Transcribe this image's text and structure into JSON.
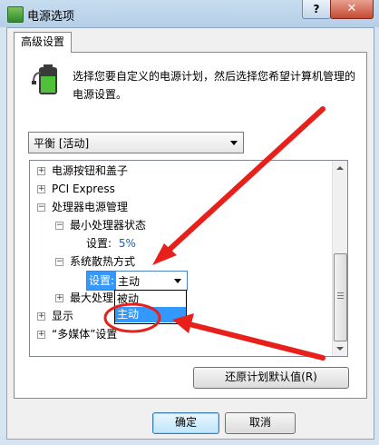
{
  "window": {
    "title": "电源选项",
    "help_label": "?",
    "close_label": "✕"
  },
  "tab": {
    "label": "高级设置"
  },
  "description": "选择您要自定义的电源计划，然后选择您希望计算机管理的电源设置。",
  "plan_select": {
    "value": "平衡 [活动]"
  },
  "tree": {
    "items": [
      {
        "expander": "+",
        "label": "电源按钮和盖子"
      },
      {
        "expander": "+",
        "label": "PCI Express"
      },
      {
        "expander": "−",
        "label": "处理器电源管理"
      },
      {
        "expander": "−",
        "label": "最小处理器状态"
      },
      {
        "setting_label": "设置:",
        "value": "5%"
      },
      {
        "expander": "−",
        "label": "系统散热方式"
      },
      {
        "expander": "+",
        "label": "最大处理"
      },
      {
        "expander": "+",
        "label": "显示"
      },
      {
        "expander": "+",
        "label": "“多媒体”设置"
      }
    ],
    "combo": {
      "label": "设置:",
      "value": "主动"
    },
    "dropdown_options": [
      "被动",
      "主动"
    ],
    "selected_option": "主动"
  },
  "buttons": {
    "restore": "还原计划默认值(R)",
    "ok": "确定",
    "cancel": "取消"
  },
  "colors": {
    "annotation_red": "#e8201c",
    "highlight": "#3399ff"
  },
  "icons": [
    "power-options-icon",
    "battery-plug-icon",
    "combo-arrow-icon",
    "scroll-up-icon",
    "scroll-down-icon"
  ]
}
